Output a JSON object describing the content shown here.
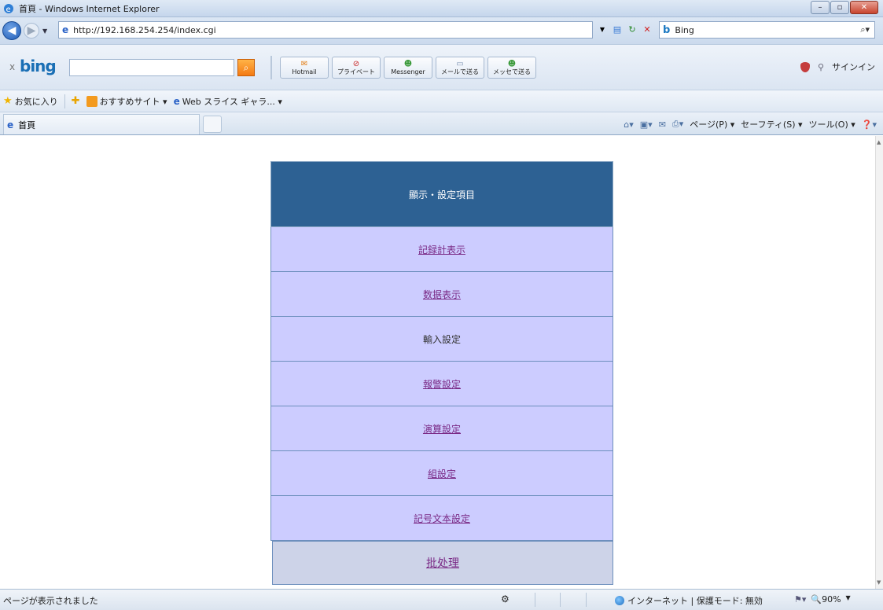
{
  "window": {
    "title": "首頁 - Windows Internet Explorer"
  },
  "address_bar": {
    "url": "http://192.168.254.254/index.cgi",
    "search_engine": "Bing"
  },
  "bing_toolbar": {
    "logo": "bing",
    "buttons": [
      {
        "label": "Hotmail",
        "icon": "hotmail-icon"
      },
      {
        "label": "プライベート",
        "icon": "private-icon"
      },
      {
        "label": "Messenger",
        "icon": "messenger-icon"
      },
      {
        "label": "メールで送る",
        "icon": "mail-icon"
      },
      {
        "label": "メッセで送る",
        "icon": "messenger-send-icon"
      }
    ],
    "signin": "サインイン"
  },
  "favorites_bar": {
    "favorites": "お気に入り",
    "suggested": "おすすめサイト ▾",
    "web_slice": "Web スライス ギャラ... ▾"
  },
  "tab": {
    "title": "首頁"
  },
  "command_bar": {
    "page": "ページ(P) ▾",
    "safety": "セーフティ(S) ▾",
    "tools": "ツール(O) ▾"
  },
  "menu": {
    "header": "顯示・設定項目",
    "items": [
      "記録計表示",
      "数据表示",
      "輸入設定",
      "報警設定",
      "演算設定",
      "組設定",
      "記号文本設定"
    ],
    "last_item": "批处理"
  },
  "status_bar": {
    "message": "ページが表示されました",
    "zone": "インターネット | 保護モード: 無効",
    "zoom": "90%"
  },
  "colors": {
    "header_bg": "#2d6193",
    "item_bg": "#ccccff",
    "last_item_bg": "#cdd3e8",
    "link": "#7a2a86"
  }
}
